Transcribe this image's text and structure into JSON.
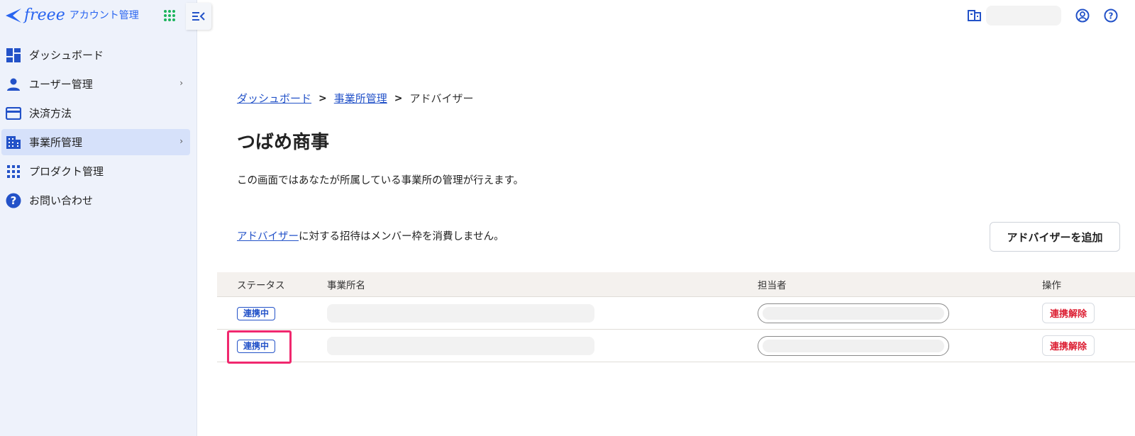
{
  "app": {
    "logo_text": "freee",
    "logo_sub": "アカウント管理"
  },
  "sidebar": {
    "items": [
      {
        "label": "ダッシュボード",
        "icon": "dashboard-icon"
      },
      {
        "label": "ユーザー管理",
        "icon": "person-icon",
        "chevron": "›"
      },
      {
        "label": "決済方法",
        "icon": "credit-card-icon"
      },
      {
        "label": "事業所管理",
        "icon": "building-icon",
        "chevron": "›",
        "active": true
      },
      {
        "label": "プロダクト管理",
        "icon": "grid-icon"
      },
      {
        "label": "お問い合わせ",
        "icon": "help-circle-icon"
      }
    ]
  },
  "breadcrumb": {
    "item1": "ダッシュボード",
    "item2": "事業所管理",
    "current": "アドバイザー"
  },
  "page": {
    "title": "つばめ商事",
    "description": "この画面ではあなたが所属している事業所の管理が行えます。",
    "note_link": "アドバイザー",
    "note_text": "に対する招待はメンバー枠を消費しません。",
    "add_button": "アドバイザーを追加"
  },
  "table": {
    "headers": {
      "status": "ステータス",
      "office": "事業所名",
      "assignee": "担当者",
      "action": "操作"
    },
    "rows": [
      {
        "status": "連携中",
        "action": "連携解除"
      },
      {
        "status": "連携中",
        "action": "連携解除"
      }
    ]
  },
  "colors": {
    "accent": "#2352c8",
    "danger": "#dc1e32",
    "highlight": "#f0286e"
  }
}
